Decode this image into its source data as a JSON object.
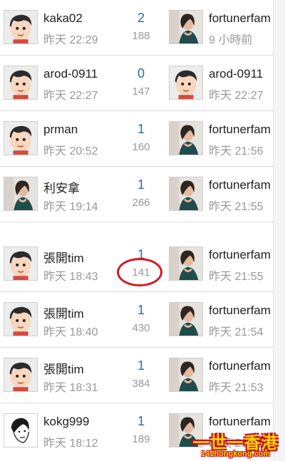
{
  "threads": [
    {
      "author": "kaka02",
      "author_avatar": "cartoon-boy",
      "time": "昨天 22:29",
      "replies": "2",
      "views": "188",
      "last_poster": "fortunerfam",
      "last_avatar": "photo-woman",
      "last_time": "9 小時前"
    },
    {
      "author": "arod-0911",
      "author_avatar": "cartoon-boy",
      "time": "昨天 22:27",
      "replies": "0",
      "views": "147",
      "last_poster": "arod-0911",
      "last_avatar": "cartoon-boy",
      "last_time": "昨天 22:27"
    },
    {
      "author": "prman",
      "author_avatar": "cartoon-boy",
      "time": "昨天 20:52",
      "replies": "1",
      "views": "160",
      "last_poster": "fortunerfam",
      "last_avatar": "photo-woman",
      "last_time": "昨天 21:56"
    },
    {
      "author": "利安拿",
      "author_avatar": "photo-woman",
      "time": "昨天 19:14",
      "replies": "1",
      "views": "266",
      "last_poster": "fortunerfam",
      "last_avatar": "photo-woman",
      "last_time": "昨天 21:55"
    },
    {
      "author": "張開tim",
      "author_avatar": "cartoon-boy",
      "time": "昨天 18:43",
      "replies": "1",
      "views": "141",
      "last_poster": "fortunerfam",
      "last_avatar": "photo-woman",
      "last_time": "昨天 21:55"
    },
    {
      "author": "張開tim",
      "author_avatar": "cartoon-boy",
      "time": "昨天 18:40",
      "replies": "1",
      "views": "430",
      "last_poster": "fortunerfam",
      "last_avatar": "photo-woman",
      "last_time": "昨天 21:54"
    },
    {
      "author": "張開tim",
      "author_avatar": "cartoon-boy",
      "time": "昨天 18:31",
      "replies": "1",
      "views": "384",
      "last_poster": "fortunerfam",
      "last_avatar": "photo-woman",
      "last_time": "昨天 21:53"
    },
    {
      "author": "kokg999",
      "author_avatar": "sketch-portrait",
      "time": "昨天 18:12",
      "replies": "1",
      "views": "189",
      "last_poster": "fortunerfam",
      "last_avatar": "photo-woman",
      "last_time": "昨天 21:52"
    }
  ],
  "highlight": {
    "views_value": "141",
    "color": "#d11a22"
  },
  "watermark": {
    "title": "一世一香港",
    "site": "141hongkong.com"
  },
  "colors": {
    "replies": "#2a6cab",
    "muted": "#999999",
    "divider": "#d9dde2"
  }
}
